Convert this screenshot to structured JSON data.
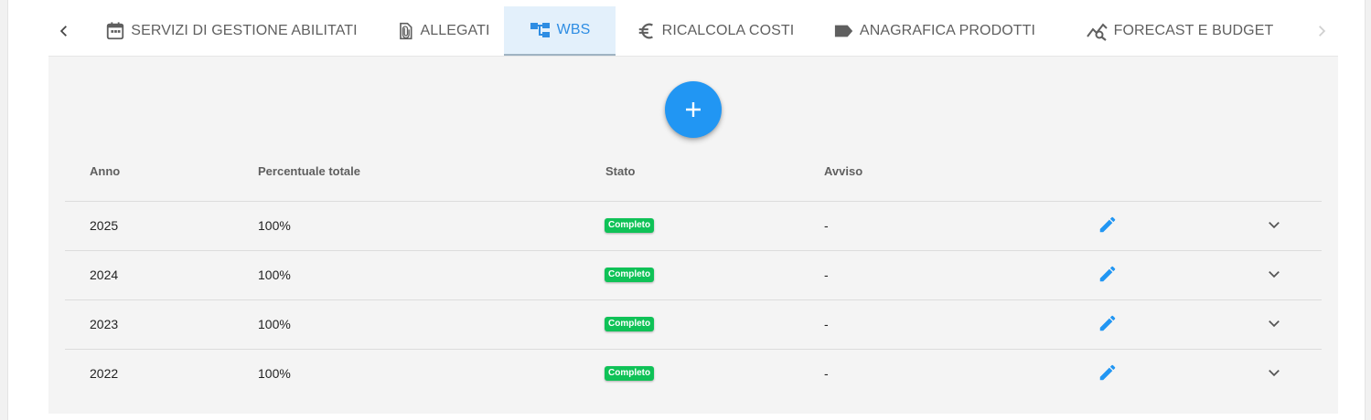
{
  "tabs": [
    {
      "label": "SERVIZI DI GESTIONE ABILITATI",
      "icon": "calendar-icon"
    },
    {
      "label": "ALLEGATI",
      "icon": "attachment-icon"
    },
    {
      "label": "WBS",
      "icon": "hierarchy-icon",
      "active": true
    },
    {
      "label": "RICALCOLA COSTI",
      "icon": "euro-icon"
    },
    {
      "label": "ANAGRAFICA PRODOTTI",
      "icon": "label-icon"
    },
    {
      "label": "FORECAST E BUDGET",
      "icon": "chart-search-icon"
    }
  ],
  "add_button": {
    "icon": "plus-icon"
  },
  "table": {
    "headers": {
      "anno": "Anno",
      "percentuale": "Percentuale totale",
      "stato": "Stato",
      "avviso": "Avviso"
    },
    "rows": [
      {
        "anno": "2025",
        "percentuale": "100%",
        "stato": "Completo",
        "avviso": "-"
      },
      {
        "anno": "2024",
        "percentuale": "100%",
        "stato": "Completo",
        "avviso": "-"
      },
      {
        "anno": "2023",
        "percentuale": "100%",
        "stato": "Completo",
        "avviso": "-"
      },
      {
        "anno": "2022",
        "percentuale": "100%",
        "stato": "Completo",
        "avviso": "-"
      }
    ]
  },
  "colors": {
    "accent": "#2196f3",
    "active_tab_bg": "#e3f0fb",
    "badge_green": "#0fc257",
    "panel_bg": "#f4f4f4"
  }
}
